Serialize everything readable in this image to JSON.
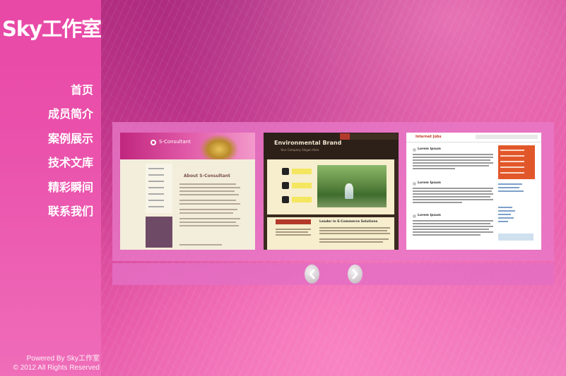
{
  "site": {
    "logo": "Sky工作室"
  },
  "nav": {
    "items": [
      {
        "label": "首页"
      },
      {
        "label": "成员简介"
      },
      {
        "label": "案例展示"
      },
      {
        "label": "技术文库"
      },
      {
        "label": "精彩瞬间"
      },
      {
        "label": "联系我们"
      }
    ]
  },
  "footer": {
    "powered": "Powered By Sky工作室",
    "copyright": "© 2012 All Rights Reserved"
  },
  "slider": {
    "slides": [
      {
        "site_title": "S-Consultant",
        "heading": "About S-Consultant"
      },
      {
        "site_title": "Environmental Brand",
        "tagline": "Your Company Slogan Here",
        "button": "CLIENT TESTIMONIALS",
        "lead": "Leader in E-Commerce Solutions"
      },
      {
        "site_title": "Internet Jobs",
        "post_title": "Lorem Ipsum"
      }
    ],
    "prev_icon": "chevron-left-icon",
    "next_icon": "chevron-right-icon"
  },
  "colors": {
    "sidebar": "#e848a6",
    "background": "#cf3e92",
    "slider_panel": "#e878c8"
  }
}
